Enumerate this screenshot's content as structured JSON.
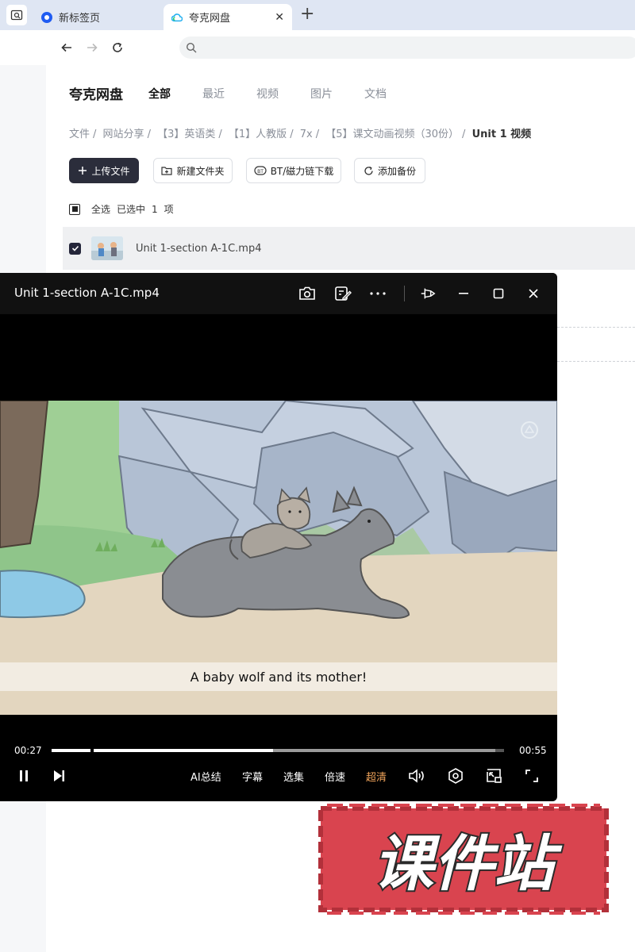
{
  "browser": {
    "tabs": [
      {
        "label": "新标签页"
      },
      {
        "label": "夸克网盘",
        "active": true
      }
    ]
  },
  "drive": {
    "app_title": "夸克网盘",
    "nav_tabs": [
      "全部",
      "最近",
      "视频",
      "图片",
      "文档"
    ],
    "breadcrumb": [
      "文件",
      "网站分享",
      "【3】英语类",
      "【1】人教版",
      "7x",
      "【5】课文动画视频（30份）",
      "Unit 1 视频"
    ],
    "actions": {
      "upload": "上传文件",
      "new_folder": "新建文件夹",
      "bt_download": "BT/磁力链下载",
      "add_backup": "添加备份"
    },
    "select": {
      "all": "全选",
      "selected": "已选中",
      "count": "1",
      "unit": "项"
    },
    "files": [
      {
        "name": "Unit 1-section A-1C.mp4",
        "checked": true
      }
    ]
  },
  "player": {
    "title": "Unit 1-section A-1C.mp4",
    "subtitle": "A baby wolf and its mother!",
    "current_time": "00:27",
    "duration": "00:55",
    "progress": 0.49,
    "buffered": 0.98,
    "controls": {
      "ai_summary": "AI总结",
      "captions": "字幕",
      "episodes": "选集",
      "speed": "倍速",
      "quality": "超清"
    }
  },
  "watermark": {
    "text": "课件站"
  },
  "colors": {
    "primary_button": "#2b2d3b",
    "quality_accent": "#f0a35a",
    "watermark_red": "#d9444f"
  }
}
